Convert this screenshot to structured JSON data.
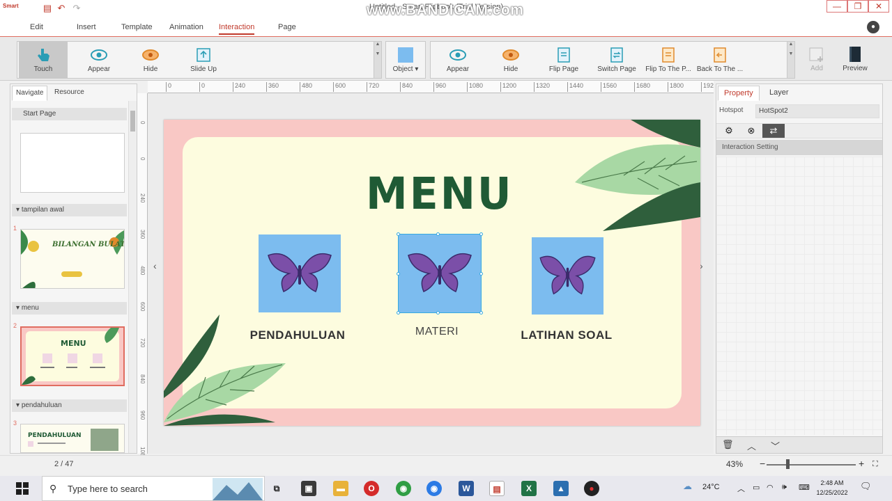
{
  "app": {
    "logo_text": "Smart",
    "window_title": "Untitled - Smart Flipbook (Trial Version)",
    "watermark": "www.BANDICAM.com"
  },
  "menu": {
    "items": [
      "Edit",
      "Insert",
      "Template",
      "Animation",
      "Interaction",
      "Page"
    ],
    "active_index": 4
  },
  "ribbon": {
    "left_tools": [
      {
        "label": "Touch",
        "icon": "touch-hand-icon"
      },
      {
        "label": "Appear",
        "icon": "eye-icon"
      },
      {
        "label": "Hide",
        "icon": "hide-eye-icon"
      },
      {
        "label": "Slide Up",
        "icon": "slide-up-icon"
      }
    ],
    "object_label": "Object",
    "right_tools": [
      {
        "label": "Appear",
        "icon": "eye-icon"
      },
      {
        "label": "Hide",
        "icon": "hide-eye-icon"
      },
      {
        "label": "Flip Page",
        "icon": "flip-page-icon"
      },
      {
        "label": "Switch Page",
        "icon": "switch-page-icon"
      },
      {
        "label": "Flip To The P...",
        "icon": "flip-to-page-icon"
      },
      {
        "label": "Back To The ...",
        "icon": "back-to-page-icon"
      }
    ],
    "add_label": "Add",
    "preview_label": "Preview"
  },
  "left_panel": {
    "tabs": [
      "Navigate",
      "Resource"
    ],
    "start_page": "Start Page",
    "sections": [
      "tampilan awal",
      "menu",
      "pendahuluan"
    ],
    "page_numbers": [
      "1",
      "2",
      "3"
    ],
    "thumb_texts": {
      "t1_title": "BILANGAN BULAT",
      "t2_title": "MENU",
      "t3_title": "PENDAHULUAN"
    }
  },
  "ruler": {
    "h_ticks": [
      "0",
      "0",
      "240",
      "360",
      "480",
      "600",
      "720",
      "840",
      "960",
      "1080",
      "1200",
      "1320",
      "1440",
      "1560",
      "1680",
      "1800",
      "192"
    ],
    "v_ticks": [
      "0",
      "0",
      "240",
      "360",
      "480",
      "600",
      "720",
      "840",
      "960",
      "1080"
    ]
  },
  "slide": {
    "title": "MENU",
    "tiles": [
      {
        "label": "PENDAHULUAN"
      },
      {
        "label": "MATERI"
      },
      {
        "label": "LATIHAN SOAL"
      }
    ],
    "colors": {
      "border": "#f9c8c5",
      "background": "#fdfcdf",
      "title": "#1f5a35",
      "tile": "#7cbcef",
      "butterfly": "#7b4fa8"
    }
  },
  "right_panel": {
    "tabs": [
      "Property",
      "Layer"
    ],
    "hotspot_label": "Hotspot",
    "hotspot_value": "HotSpot2",
    "interaction_setting": "Interaction Setting"
  },
  "status": {
    "page_indicator": "2 / 47",
    "zoom": "43%",
    "zoom_level": 0.43
  },
  "taskbar": {
    "search_placeholder": "Type here to search",
    "weather": "24°C",
    "time": "2:48 AM",
    "date": "12/25/2022"
  }
}
